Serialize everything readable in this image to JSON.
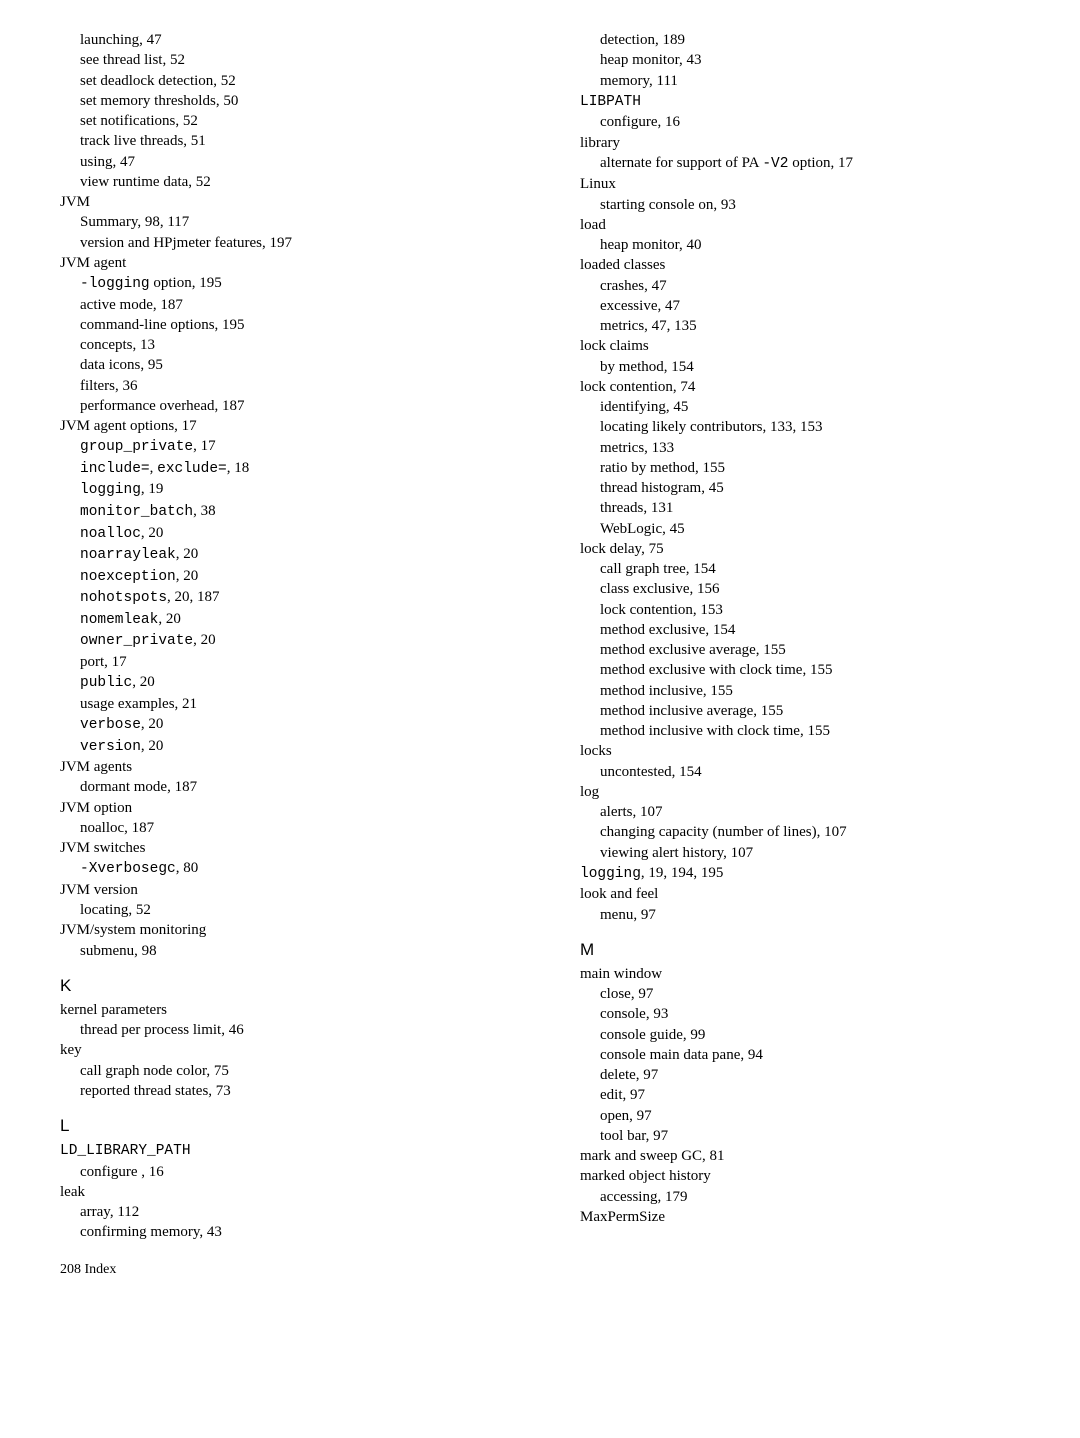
{
  "left": [
    {
      "text": "launching, 47",
      "sub": true
    },
    {
      "text": "see thread list, 52",
      "sub": true
    },
    {
      "text": "set deadlock detection, 52",
      "sub": true
    },
    {
      "text": "set memory thresholds, 50",
      "sub": true
    },
    {
      "text": "set notifications, 52",
      "sub": true
    },
    {
      "text": "track live threads, 51",
      "sub": true
    },
    {
      "text": "using, 47",
      "sub": true
    },
    {
      "text": "view runtime data, 52",
      "sub": true
    },
    {
      "text": "JVM"
    },
    {
      "text": "Summary, 98, 117",
      "sub": true
    },
    {
      "text": "version and HPjmeter features, 197",
      "sub": true
    },
    {
      "text": "JVM agent"
    },
    {
      "pre": "-logging",
      "post": " option, 195",
      "sub": true
    },
    {
      "text": "active mode, 187",
      "sub": true
    },
    {
      "text": "command-line options, 195",
      "sub": true
    },
    {
      "text": "concepts, 13",
      "sub": true
    },
    {
      "text": "data icons, 95",
      "sub": true
    },
    {
      "text": "filters, 36",
      "sub": true
    },
    {
      "text": "performance overhead, 187",
      "sub": true
    },
    {
      "text": "JVM agent options, 17"
    },
    {
      "pre": "group_private",
      "post": ", 17",
      "sub": true
    },
    {
      "pre": "include=",
      "mid": ", ",
      "pre2": "exclude=",
      "post": ", 18",
      "sub": true
    },
    {
      "pre": "logging",
      "post": ", 19",
      "sub": true
    },
    {
      "pre": "monitor_batch",
      "post": ", 38",
      "sub": true
    },
    {
      "pre": "noalloc",
      "post": ", 20",
      "sub": true
    },
    {
      "pre": "noarrayleak",
      "post": ", 20",
      "sub": true
    },
    {
      "pre": "noexception",
      "post": ", 20",
      "sub": true
    },
    {
      "pre": "nohotspots",
      "post": ", 20, 187",
      "sub": true
    },
    {
      "pre": "nomemleak",
      "post": ", 20",
      "sub": true
    },
    {
      "pre": "owner_private",
      "post": ", 20",
      "sub": true
    },
    {
      "text": "port, 17",
      "sub": true
    },
    {
      "pre": "public",
      "post": ", 20",
      "sub": true
    },
    {
      "text": "usage examples, 21",
      "sub": true
    },
    {
      "pre": "verbose",
      "post": ", 20",
      "sub": true
    },
    {
      "pre": "version",
      "post": ", 20",
      "sub": true
    },
    {
      "text": "JVM agents"
    },
    {
      "text": "dormant mode, 187",
      "sub": true
    },
    {
      "text": "JVM option"
    },
    {
      "text": "noalloc, 187",
      "sub": true
    },
    {
      "text": "JVM switches"
    },
    {
      "pre": "-Xverbosegc",
      "post": ", 80",
      "sub": true
    },
    {
      "text": "JVM version"
    },
    {
      "text": "locating, 52",
      "sub": true
    },
    {
      "text": "JVM/system monitoring"
    },
    {
      "text": "submenu, 98",
      "sub": true
    },
    {
      "letter": "K"
    },
    {
      "text": "kernel parameters"
    },
    {
      "text": "thread per process limit, 46",
      "sub": true
    },
    {
      "text": "key"
    },
    {
      "text": "call graph node color, 75",
      "sub": true
    },
    {
      "text": "reported thread states, 73",
      "sub": true
    },
    {
      "letter": "L"
    },
    {
      "pre": "LD_LIBRARY_PATH"
    },
    {
      "text": "configure , 16",
      "sub": true
    },
    {
      "text": "leak"
    },
    {
      "text": "array, 112",
      "sub": true
    },
    {
      "text": "confirming memory, 43",
      "sub": true
    }
  ],
  "right": [
    {
      "text": "detection, 189",
      "sub": true
    },
    {
      "text": "heap monitor, 43",
      "sub": true
    },
    {
      "text": "memory, 111",
      "sub": true
    },
    {
      "pre": "LIBPATH"
    },
    {
      "text": "configure, 16",
      "sub": true
    },
    {
      "text": "library"
    },
    {
      "plain1": "alternate for support of PA ",
      "mono1": "-V2",
      "plain2": " option, 17",
      "sub": true
    },
    {
      "text": "Linux"
    },
    {
      "text": "starting console on, 93",
      "sub": true
    },
    {
      "text": "load"
    },
    {
      "text": "heap monitor, 40",
      "sub": true
    },
    {
      "text": "loaded classes"
    },
    {
      "text": "crashes, 47",
      "sub": true
    },
    {
      "text": "excessive, 47",
      "sub": true
    },
    {
      "text": "metrics, 47, 135",
      "sub": true
    },
    {
      "text": "lock claims"
    },
    {
      "text": "by method, 154",
      "sub": true
    },
    {
      "text": "lock contention, 74"
    },
    {
      "text": "identifying, 45",
      "sub": true
    },
    {
      "text": "locating likely contributors, 133, 153",
      "sub": true
    },
    {
      "text": "metrics, 133",
      "sub": true
    },
    {
      "text": "ratio by method, 155",
      "sub": true
    },
    {
      "text": "thread histogram, 45",
      "sub": true
    },
    {
      "text": "threads, 131",
      "sub": true
    },
    {
      "text": "WebLogic, 45",
      "sub": true
    },
    {
      "text": "lock delay, 75"
    },
    {
      "text": "call graph tree, 154",
      "sub": true
    },
    {
      "text": "class exclusive, 156",
      "sub": true
    },
    {
      "text": "lock contention, 153",
      "sub": true
    },
    {
      "text": "method exclusive, 154",
      "sub": true
    },
    {
      "text": "method exclusive average, 155",
      "sub": true
    },
    {
      "text": "method exclusive with clock time, 155",
      "sub": true
    },
    {
      "text": "method inclusive, 155",
      "sub": true
    },
    {
      "text": "method inclusive average, 155",
      "sub": true
    },
    {
      "text": "method inclusive with clock time, 155",
      "sub": true
    },
    {
      "text": "locks"
    },
    {
      "text": "uncontested, 154",
      "sub": true
    },
    {
      "text": "log"
    },
    {
      "text": "alerts, 107",
      "sub": true
    },
    {
      "text": "changing capacity (number of lines), 107",
      "sub": true
    },
    {
      "text": "viewing alert history, 107",
      "sub": true
    },
    {
      "pre": "logging",
      "post": ", 19, 194, 195"
    },
    {
      "text": "look and feel"
    },
    {
      "text": "menu, 97",
      "sub": true
    },
    {
      "letter": "M"
    },
    {
      "text": "main window"
    },
    {
      "text": "close, 97",
      "sub": true
    },
    {
      "text": "console, 93",
      "sub": true
    },
    {
      "text": "console guide, 99",
      "sub": true
    },
    {
      "text": "console main data pane, 94",
      "sub": true
    },
    {
      "text": "delete, 97",
      "sub": true
    },
    {
      "text": "edit, 97",
      "sub": true
    },
    {
      "text": "open, 97",
      "sub": true
    },
    {
      "text": "tool bar, 97",
      "sub": true
    },
    {
      "text": "mark and sweep GC, 81"
    },
    {
      "text": "marked object history"
    },
    {
      "text": "accessing, 179",
      "sub": true
    },
    {
      "text": "MaxPermSize"
    }
  ],
  "footer": "208    Index"
}
